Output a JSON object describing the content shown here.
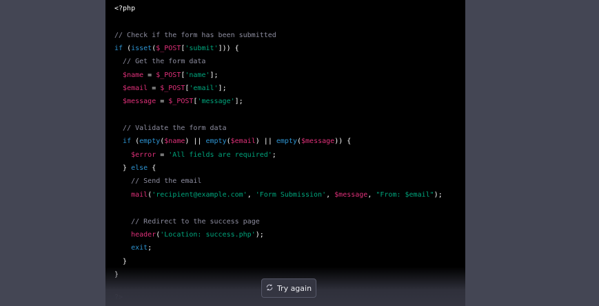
{
  "code": {
    "language": "php",
    "lines": [
      [
        [
          "plain",
          "<?php"
        ]
      ],
      [],
      [
        [
          "comment",
          "// Check if the form has been submitted"
        ]
      ],
      [
        [
          "keyword",
          "if"
        ],
        [
          "plain",
          " ("
        ],
        [
          "keyword",
          "isset"
        ],
        [
          "plain",
          "("
        ],
        [
          "var",
          "$_POST"
        ],
        [
          "plain",
          "["
        ],
        [
          "string",
          "'submit'"
        ],
        [
          "plain",
          "])) {"
        ]
      ],
      [
        [
          "plain",
          "  "
        ],
        [
          "comment",
          "// Get the form data"
        ]
      ],
      [
        [
          "plain",
          "  "
        ],
        [
          "var",
          "$name"
        ],
        [
          "plain",
          " = "
        ],
        [
          "var",
          "$_POST"
        ],
        [
          "plain",
          "["
        ],
        [
          "string",
          "'name'"
        ],
        [
          "plain",
          "];"
        ]
      ],
      [
        [
          "plain",
          "  "
        ],
        [
          "var",
          "$email"
        ],
        [
          "plain",
          " = "
        ],
        [
          "var",
          "$_POST"
        ],
        [
          "plain",
          "["
        ],
        [
          "string",
          "'email'"
        ],
        [
          "plain",
          "];"
        ]
      ],
      [
        [
          "plain",
          "  "
        ],
        [
          "var",
          "$message"
        ],
        [
          "plain",
          " = "
        ],
        [
          "var",
          "$_POST"
        ],
        [
          "plain",
          "["
        ],
        [
          "string",
          "'message'"
        ],
        [
          "plain",
          "];"
        ]
      ],
      [],
      [
        [
          "plain",
          "  "
        ],
        [
          "comment",
          "// Validate the form data"
        ]
      ],
      [
        [
          "plain",
          "  "
        ],
        [
          "keyword",
          "if"
        ],
        [
          "plain",
          " ("
        ],
        [
          "keyword",
          "empty"
        ],
        [
          "plain",
          "("
        ],
        [
          "var",
          "$name"
        ],
        [
          "plain",
          ") || "
        ],
        [
          "keyword",
          "empty"
        ],
        [
          "plain",
          "("
        ],
        [
          "var",
          "$email"
        ],
        [
          "plain",
          ") || "
        ],
        [
          "keyword",
          "empty"
        ],
        [
          "plain",
          "("
        ],
        [
          "var",
          "$message"
        ],
        [
          "plain",
          ")) {"
        ]
      ],
      [
        [
          "plain",
          "    "
        ],
        [
          "var",
          "$error"
        ],
        [
          "plain",
          " = "
        ],
        [
          "string",
          "'All fields are required'"
        ],
        [
          "plain",
          ";"
        ]
      ],
      [
        [
          "plain",
          "  } "
        ],
        [
          "keyword",
          "else"
        ],
        [
          "plain",
          " {"
        ]
      ],
      [
        [
          "plain",
          "    "
        ],
        [
          "comment",
          "// Send the email"
        ]
      ],
      [
        [
          "plain",
          "    "
        ],
        [
          "var",
          "mail"
        ],
        [
          "plain",
          "("
        ],
        [
          "string",
          "'recipient@example.com'"
        ],
        [
          "plain",
          ", "
        ],
        [
          "string",
          "'Form Submission'"
        ],
        [
          "plain",
          ", "
        ],
        [
          "var",
          "$message"
        ],
        [
          "plain",
          ", "
        ],
        [
          "string",
          "\"From: $email\""
        ],
        [
          "plain",
          ");"
        ]
      ],
      [],
      [
        [
          "plain",
          "    "
        ],
        [
          "comment",
          "// Redirect to the success page"
        ]
      ],
      [
        [
          "plain",
          "    "
        ],
        [
          "var",
          "header"
        ],
        [
          "plain",
          "("
        ],
        [
          "string",
          "'Location: success.php'"
        ],
        [
          "plain",
          ");"
        ]
      ],
      [
        [
          "plain",
          "    "
        ],
        [
          "keyword",
          "exit"
        ],
        [
          "plain",
          ";"
        ]
      ],
      [
        [
          "plain",
          "  }"
        ]
      ],
      [
        [
          "plain",
          "}"
        ]
      ]
    ],
    "trailing": "?>"
  },
  "try_again_button": {
    "label": "Try again",
    "icon": "refresh-icon"
  },
  "colors": {
    "comment": "#8e8ea0",
    "keyword": "#2e95d3",
    "variable": "#df3079",
    "string": "#00a67d"
  }
}
